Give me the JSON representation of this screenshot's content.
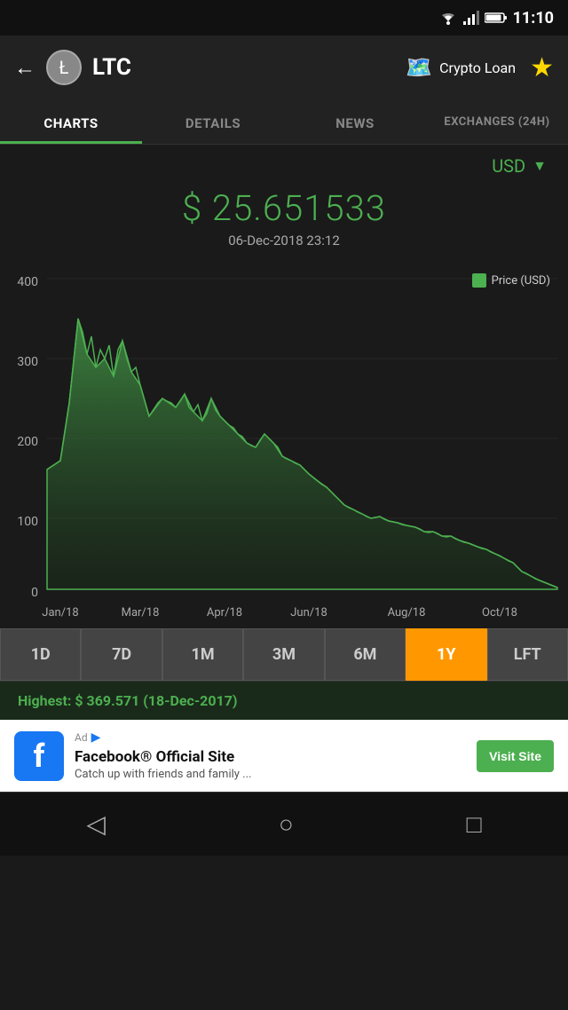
{
  "statusBar": {
    "time": "11:10"
  },
  "header": {
    "backLabel": "←",
    "coinLogo": "Ł",
    "coinName": "LTC",
    "cryptoLoan": "Crypto Loan",
    "starLabel": "★"
  },
  "tabs": [
    {
      "id": "charts",
      "label": "CHARTS",
      "active": true
    },
    {
      "id": "details",
      "label": "DETAILS",
      "active": false
    },
    {
      "id": "news",
      "label": "NEWS",
      "active": false
    },
    {
      "id": "exchanges",
      "label": "EXCHANGES (24H)",
      "active": false
    }
  ],
  "currency": {
    "selected": "USD"
  },
  "price": {
    "value": "$ 25.651533",
    "date": "06-Dec-2018 23:12"
  },
  "chart": {
    "legend": "Price (USD)",
    "yLabels": [
      "400",
      "300",
      "200",
      "100",
      "0"
    ],
    "xLabels": [
      "Jan/18",
      "Mar/18",
      "Apr/18",
      "Jun/18",
      "Aug/18",
      "Oct/18"
    ]
  },
  "timeRange": {
    "buttons": [
      {
        "label": "1D",
        "active": false
      },
      {
        "label": "7D",
        "active": false
      },
      {
        "label": "1M",
        "active": false
      },
      {
        "label": "3M",
        "active": false
      },
      {
        "label": "6M",
        "active": false
      },
      {
        "label": "1Y",
        "active": true
      },
      {
        "label": "LFT",
        "active": false
      }
    ]
  },
  "highest": {
    "text": "Highest: $ 369.571 (18-Dec-2017)"
  },
  "ad": {
    "adLabel": "Ad",
    "fbLogo": "f",
    "title": "Facebook® Official Site",
    "subtitle": "Catch up with friends and family ...",
    "ctaButton": "Visit Site"
  },
  "bottomNav": {
    "back": "◁",
    "home": "○",
    "square": "□"
  }
}
